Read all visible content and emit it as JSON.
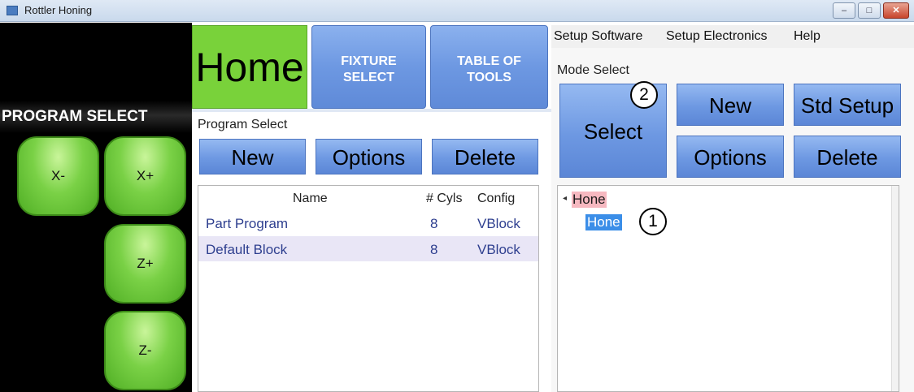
{
  "window": {
    "title": "Rottler Honing",
    "min_label": "–",
    "max_label": "□",
    "close_label": "✕"
  },
  "left_panel": {
    "title": "PROGRAM SELECT",
    "jog_buttons": {
      "x_minus": "X-",
      "x_plus": "X+",
      "z_plus": "Z+",
      "z_minus": "Z-"
    }
  },
  "nav": {
    "home": "Home",
    "fixture_select": "FIXTURE\nSELECT",
    "table_of_tools": "TABLE OF\nTOOLS"
  },
  "program_select": {
    "label": "Program Select",
    "buttons": {
      "new": "New",
      "options": "Options",
      "delete": "Delete"
    },
    "columns": [
      "Name",
      "# Cyls",
      "Config"
    ],
    "rows": [
      {
        "name": "Part Program",
        "cyls": "8",
        "config": "VBlock"
      },
      {
        "name": "Default Block",
        "cyls": "8",
        "config": "VBlock"
      }
    ]
  },
  "menu": {
    "items": [
      "Setup Software",
      "Setup Electronics",
      "Help"
    ]
  },
  "mode_select": {
    "label": "Mode Select",
    "buttons": {
      "select": "Select",
      "new": "New",
      "std_setup": "Std Setup",
      "options": "Options",
      "delete": "Delete"
    },
    "tree": {
      "root": "Hone",
      "child": "Hone",
      "expander": "◂"
    },
    "callouts": {
      "one": "1",
      "two": "2"
    }
  },
  "colors": {
    "home_green": "#79d23a",
    "nav_blue": "#6d98e2",
    "jog_green": "#6cc83a",
    "selection_blue": "#3b8ee8",
    "root_highlight": "#f6b8c0"
  }
}
